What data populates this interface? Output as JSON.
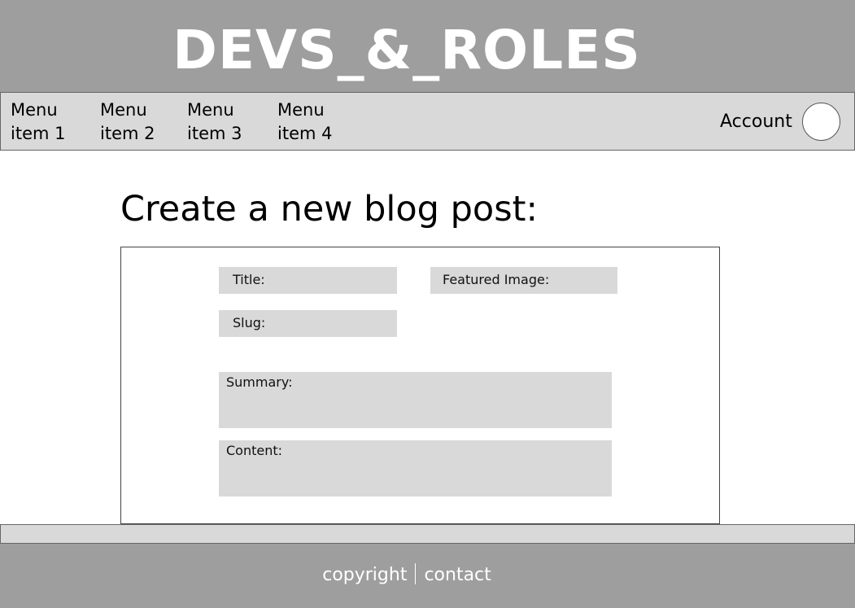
{
  "header": {
    "site_title": "DEVS_&_ROLES"
  },
  "nav": {
    "items": [
      {
        "line1": "Menu",
        "line2": "item 1"
      },
      {
        "line1": "Menu",
        "line2": "item 2"
      },
      {
        "line1": "Menu",
        "line2": "item 3"
      },
      {
        "line1": "Menu",
        "line2": "item 4"
      }
    ],
    "account_label": "Account"
  },
  "main": {
    "heading": "Create a new blog post:",
    "form": {
      "title_label": "Title:",
      "featured_image_label": "Featured Image:",
      "slug_label": "Slug:",
      "summary_label": "Summary:",
      "content_label": "Content:"
    }
  },
  "footer": {
    "copyright_label": "copyright",
    "contact_label": "contact"
  },
  "colors": {
    "header_bg": "#9e9e9e",
    "nav_bg": "#d9d9d9",
    "field_bg": "#d9d9d9",
    "text_on_header": "#ffffff"
  }
}
